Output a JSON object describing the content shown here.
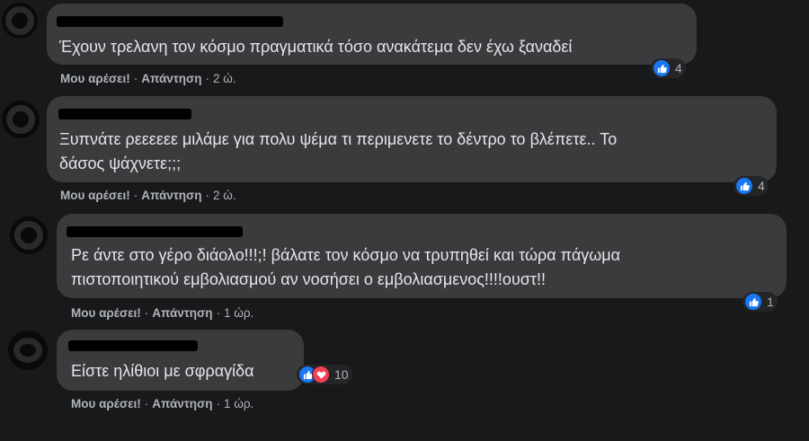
{
  "comments": [
    {
      "text": "Έχουν τρελανη τον κόσμο πραγματικά τόσο ανακάτεμα δεν έχω ξαναδεί",
      "reaction_count": "4",
      "time": "2 ώ."
    },
    {
      "text": "Ξυπνάτε ρεεεεεε μιλάμε για πολυ ψέμα τι περιμενετε το δέντρο το βλέπετε.. Το\nδάσος ψάχνετε;;;",
      "reaction_count": "4",
      "time": "2 ώ."
    },
    {
      "text": "Ρε άντε στο γέρο διάολο!!!;! βάλατε τον κόσμο να τρυπηθεί και τώρα πάγωμα\nπιστοποιητικού εμβολιασμού αν νοσήσει ο εμβολιασμενος!!!!ουστ!!",
      "reaction_count": "1",
      "time": "1 ώρ."
    },
    {
      "text": "Είστε ηλίθιοι με σφραγίδα",
      "reaction_count": "10",
      "time": "1 ώρ."
    }
  ],
  "actions": {
    "like": "Μου αρέσει!",
    "reply": "Απάντηση"
  },
  "colors": {
    "background": "#18191a",
    "bubble": "#3a3b3c",
    "like": "#1877f2",
    "love": "#f33e58"
  },
  "icons": {
    "like": "thumbs-up-icon",
    "love": "heart-icon"
  }
}
